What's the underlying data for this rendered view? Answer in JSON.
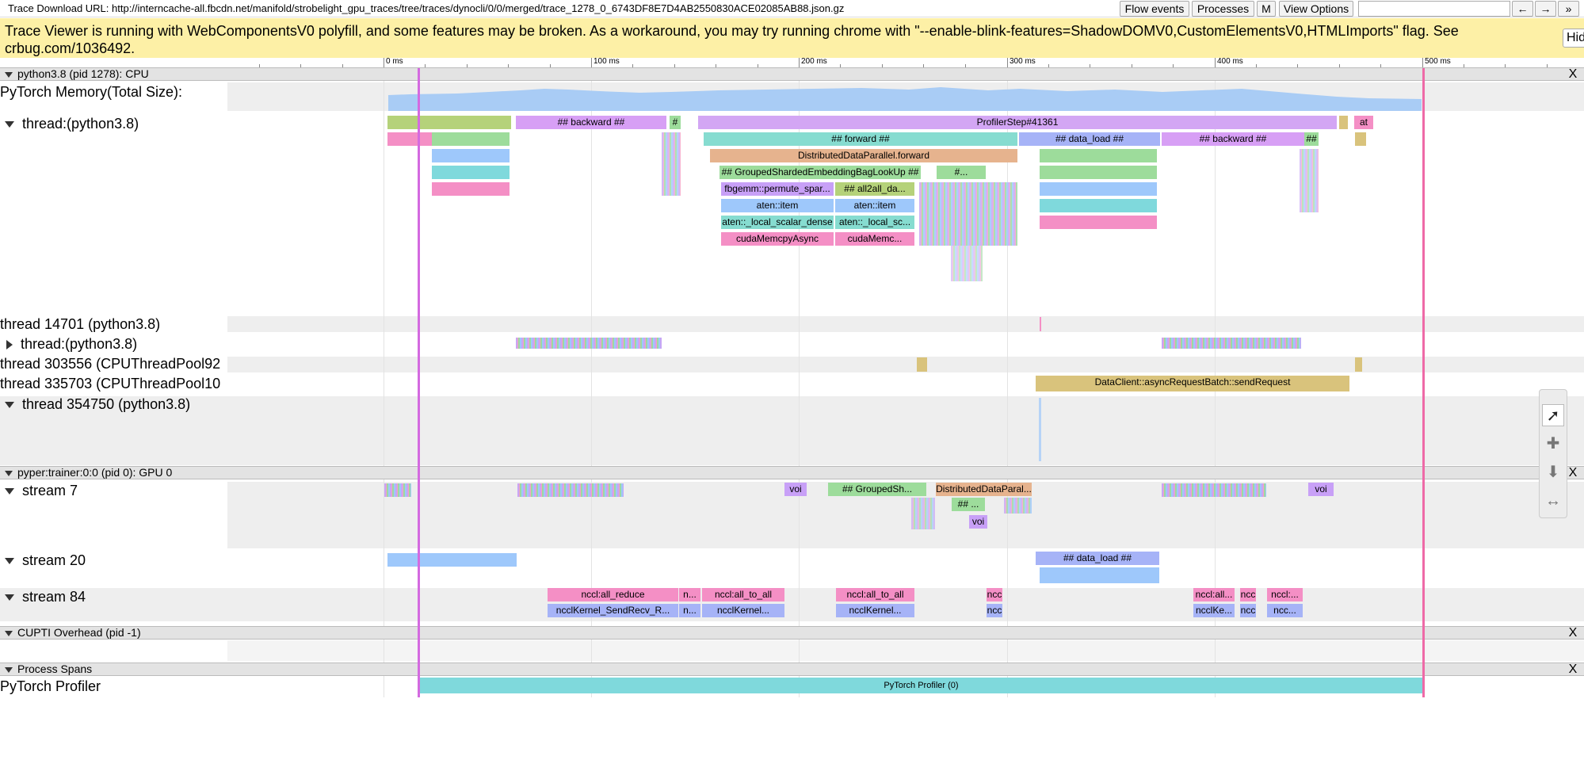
{
  "header": {
    "url_text": "Trace Download URL: http://interncache-all.fbcdn.net/manifold/strobelight_gpu_traces/tree/traces/dynocli/0/0/merged/trace_1278_0_6743DF8E7D4AB2550830ACE02085AB88.json.gz",
    "buttons": {
      "flow_events": "Flow events",
      "processes": "Processes",
      "m": "M",
      "view_options": "View Options",
      "back": "←",
      "forward": "→",
      "more": "»"
    },
    "search_placeholder": ""
  },
  "banner": {
    "text": "Trace Viewer is running with WebComponentsV0 polyfill, and some features may be broken. As a workaround, you may try running chrome with \"--enable-blink-features=ShadowDOMV0,CustomElementsV0,HTMLImports\" flag. See crbug.com/1036492.",
    "hide_label": "Hide"
  },
  "ruler": {
    "labels": [
      "0 ms",
      "100 ms",
      "200 ms",
      "300 ms",
      "400 ms",
      "500 ms"
    ]
  },
  "processes": [
    {
      "title": "python3.8 (pid 1278): CPU",
      "close": "X"
    },
    {
      "title": "pyper:trainer:0:0 (pid 0): GPU 0",
      "close": "X"
    },
    {
      "title": "CUPTI Overhead (pid -1)",
      "close": "X"
    },
    {
      "title": "Process Spans",
      "close": "X"
    }
  ],
  "tracks": {
    "memory": "PyTorch Memory(Total Size):",
    "main_thread": "thread:(python3.8)",
    "t14701": "thread 14701 (python3.8)",
    "sub_thread": "thread:(python3.8)",
    "t303556": "thread 303556 (CPUThreadPool92",
    "t335703": "thread 335703 (CPUThreadPool10",
    "t354750": "thread 354750 (python3.8)",
    "stream7": "stream 7",
    "stream20": "stream 20",
    "stream84": "stream 84",
    "pytorch_profiler": "PyTorch Profiler"
  },
  "slices": {
    "backward1": "## backward ##",
    "hash1": "#",
    "profiler_step": "ProfilerStep#41361",
    "at": "at",
    "forward": "## forward ##",
    "data_load": "## data_load ##",
    "backward2": "## backward ##",
    "hash2": "##",
    "ddp_forward": "DistributedDataParallel.forward",
    "grouped_sharded": "## GroupedShardedEmbeddingBagLookUp ##",
    "hash_dot": "#...",
    "fbgemm": "fbgemm::permute_spar...",
    "all2all": "## all2all_da...",
    "aten_item1": "aten::item",
    "aten_item2": "aten::item",
    "aten_local1": "aten::_local_scalar_dense",
    "aten_local2": "aten::_local_sc...",
    "cuda_memcpy1": "cudaMemcpyAsync",
    "cuda_memcpy2": "cudaMemc...",
    "data_client": "DataClient::asyncRequestBatch::sendRequest",
    "s7_voi1": "voi",
    "s7_grouped": "## GroupedSh...",
    "s7_ddp": "DistributedDataParal...",
    "s7_hashdots": "## ...",
    "s7_voi2": "voi",
    "s7_voi3": "voi",
    "s20_data_load": "## data_load ##",
    "nccl_all_reduce": "nccl:all_reduce",
    "nccl_n1": "n...",
    "nccl_all_to_all1": "nccl:all_to_all",
    "nccl_all_to_all2": "nccl:all_to_all",
    "nccl_ncc1": "ncc",
    "nccl_all_dots": "nccl:all...",
    "nccl_ncc2": "ncc",
    "nccl_dots2": "nccl:...",
    "kernel_sendrecv": "ncclKernel_SendRecv_R...",
    "kernel_n": "n...",
    "kernel_k1": "ncclKernel...",
    "kernel_k2": "ncclKernel...",
    "kernel_ncc1": "ncc",
    "kernel_ke": "ncclKe...",
    "kernel_ncc2": "ncc",
    "kernel_ncc3": "ncc...",
    "profiler_span": "PyTorch Profiler (0)"
  },
  "colors": {
    "pink": "#f48fc5",
    "green": "#9ddc9b",
    "blue": "#9ec8fb",
    "purple": "#c8a0f7",
    "teal": "#86dcd0",
    "orange": "#e6b38e",
    "tan": "#d9c37c",
    "lime": "#b5d27a",
    "cyan": "#7fd9dc"
  },
  "tools": [
    "select-tool",
    "pan-tool",
    "zoom-tool",
    "timing-tool"
  ]
}
